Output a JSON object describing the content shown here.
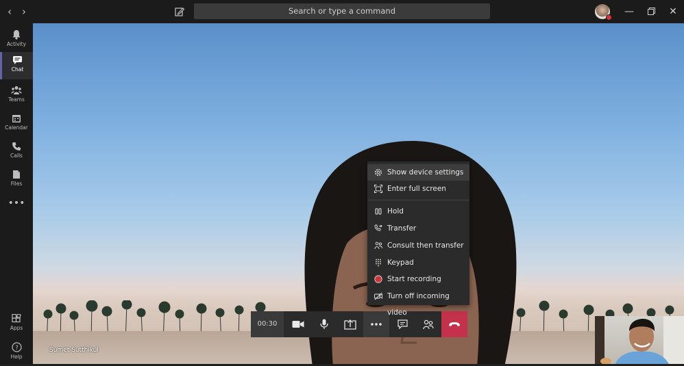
{
  "titlebar": {
    "search_placeholder": "Search or type a command",
    "back_icon": "chevron-left-icon",
    "forward_icon": "chevron-right-icon",
    "compose_icon": "compose-icon",
    "status_color": "#d13438"
  },
  "rail": {
    "items": [
      {
        "label": "Activity",
        "icon": "bell-icon"
      },
      {
        "label": "Chat",
        "icon": "chat-icon"
      },
      {
        "label": "Teams",
        "icon": "teams-icon"
      },
      {
        "label": "Calendar",
        "icon": "calendar-icon"
      },
      {
        "label": "Calls",
        "icon": "phone-icon"
      },
      {
        "label": "Files",
        "icon": "file-icon"
      }
    ],
    "bottom": [
      {
        "label": "Apps",
        "icon": "apps-icon"
      },
      {
        "label": "Help",
        "icon": "help-icon"
      }
    ],
    "active": "Chat",
    "accent": "#6264a7"
  },
  "call": {
    "caller_name": "Sumet Sutthikul",
    "timer": "00:30",
    "hangup_color": "#c4314b"
  },
  "menu": {
    "items": [
      {
        "label": "Show device settings",
        "icon": "gear-icon",
        "highlighted": true
      },
      {
        "label": "Enter full screen",
        "icon": "fullscreen-icon"
      },
      {
        "label": "Hold",
        "icon": "hold-icon"
      },
      {
        "label": "Transfer",
        "icon": "transfer-icon"
      },
      {
        "label": "Consult then transfer",
        "icon": "consult-icon"
      },
      {
        "label": "Keypad",
        "icon": "keypad-icon"
      },
      {
        "label": "Start recording",
        "icon": "record-icon"
      },
      {
        "label": "Turn off incoming video",
        "icon": "video-off-icon"
      }
    ],
    "record_color": "#d13438"
  }
}
